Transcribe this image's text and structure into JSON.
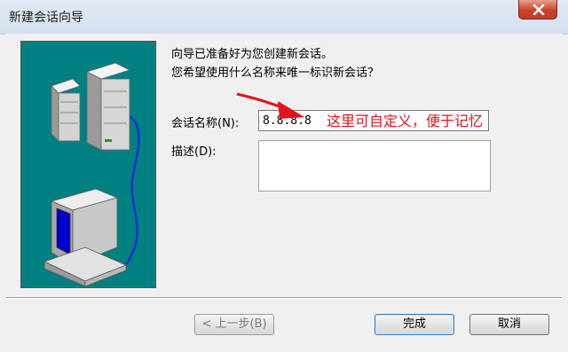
{
  "window": {
    "title": "新建会话向导"
  },
  "message": {
    "line1": "向导已准备好为您创建新会话。",
    "line2": "您希望使用什么名称来唯一标识新会话？"
  },
  "form": {
    "name_label": "会话名称(N):",
    "name_value": "8.8.8.8",
    "description_label": "描述(D):",
    "description_value": ""
  },
  "annotation": {
    "text": "这里可自定义，便于记忆",
    "color": "#e8101e"
  },
  "buttons": {
    "back": "< 上一步(B)",
    "finish": "完成",
    "cancel": "取消"
  },
  "colors": {
    "illustration_bg": "#008080",
    "close_button": "#c7432c"
  }
}
